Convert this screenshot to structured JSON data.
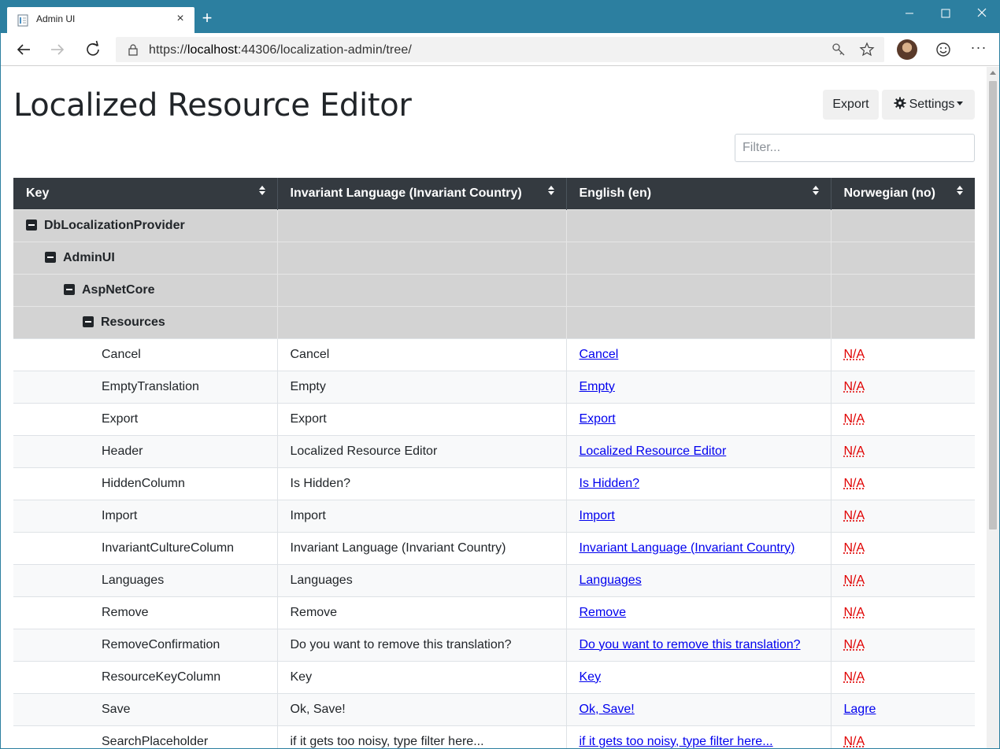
{
  "browser": {
    "tab_title": "Admin UI",
    "tab_close": "×",
    "new_tab": "+",
    "url_prefix": "https://",
    "url_host": "localhost",
    "url_rest": ":44306/localization-admin/tree/",
    "more": "···"
  },
  "page": {
    "title": "Localized Resource Editor",
    "export_label": "Export",
    "settings_label": "Settings",
    "filter_placeholder": "Filter..."
  },
  "table": {
    "headers": [
      "Key",
      "Invariant Language (Invariant Country)",
      "English (en)",
      "Norwegian (no)"
    ],
    "groups": [
      {
        "label": "DbLocalizationProvider",
        "level": 0
      },
      {
        "label": "AdminUI",
        "level": 1
      },
      {
        "label": "AspNetCore",
        "level": 2
      },
      {
        "label": "Resources",
        "level": 3
      }
    ],
    "rows": [
      {
        "key": "Cancel",
        "invariant": "Cancel",
        "en": "Cancel",
        "no": "N/A",
        "no_missing": true
      },
      {
        "key": "EmptyTranslation",
        "invariant": "Empty",
        "en": "Empty",
        "no": "N/A",
        "no_missing": true
      },
      {
        "key": "Export",
        "invariant": "Export",
        "en": "Export",
        "no": "N/A",
        "no_missing": true
      },
      {
        "key": "Header",
        "invariant": "Localized Resource Editor",
        "en": "Localized Resource Editor",
        "no": "N/A",
        "no_missing": true
      },
      {
        "key": "HiddenColumn",
        "invariant": "Is Hidden?",
        "en": "Is Hidden?",
        "no": "N/A",
        "no_missing": true
      },
      {
        "key": "Import",
        "invariant": "Import",
        "en": "Import",
        "no": "N/A",
        "no_missing": true
      },
      {
        "key": "InvariantCultureColumn",
        "invariant": "Invariant Language (Invariant Country)",
        "en": "Invariant Language (Invariant Country)",
        "no": "N/A",
        "no_missing": true
      },
      {
        "key": "Languages",
        "invariant": "Languages",
        "en": "Languages",
        "no": "N/A",
        "no_missing": true
      },
      {
        "key": "Remove",
        "invariant": "Remove",
        "en": "Remove",
        "no": "N/A",
        "no_missing": true
      },
      {
        "key": "RemoveConfirmation",
        "invariant": "Do you want to remove this translation?",
        "en": "Do you want to remove this translation?",
        "no": "N/A",
        "no_missing": true
      },
      {
        "key": "ResourceKeyColumn",
        "invariant": "Key",
        "en": "Key",
        "no": "N/A",
        "no_missing": true
      },
      {
        "key": "Save",
        "invariant": "Ok, Save!",
        "en": "Ok, Save!",
        "no": "Lagre",
        "no_missing": false
      },
      {
        "key": "SearchPlaceholder",
        "invariant": "if it gets too noisy, type filter here...",
        "en": "if it gets too noisy, type filter here...",
        "no": "N/A",
        "no_missing": true
      }
    ]
  },
  "colors": {
    "titlebar": "#2c7fa0",
    "header_bg": "#343a40",
    "group_bg": "#d3d3d3",
    "link": "#0000ee",
    "missing": "#e00000"
  }
}
